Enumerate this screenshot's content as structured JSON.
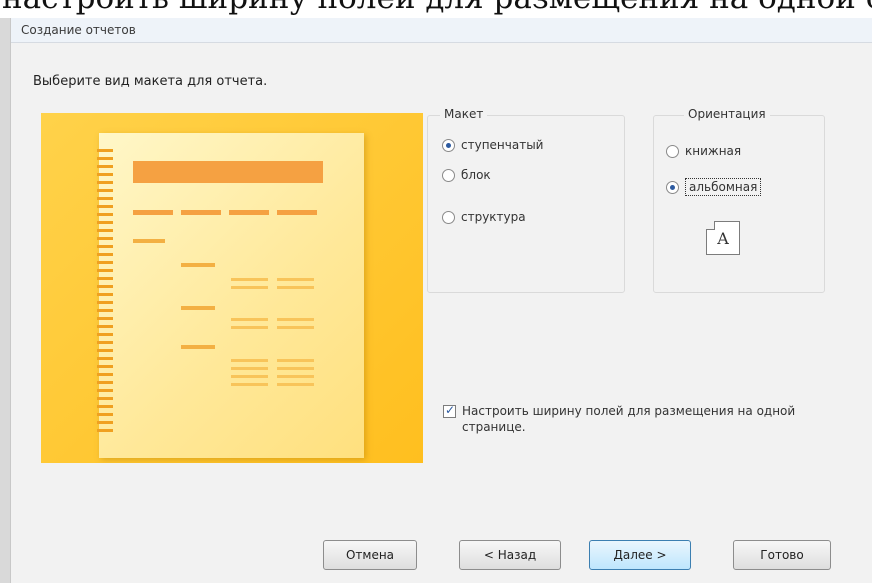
{
  "document_text": "настроить ширину полей для размещения на одной стр",
  "window": {
    "title": "Создание отчетов"
  },
  "prompt": "Выберите вид макета для отчета.",
  "layout_group": {
    "legend": "Макет",
    "options": [
      {
        "label": "ступенчатый",
        "selected": true
      },
      {
        "label": "блок",
        "selected": false
      },
      {
        "label": "структура",
        "selected": false
      }
    ]
  },
  "orientation_group": {
    "legend": "Ориентация",
    "options": [
      {
        "label": "книжная",
        "selected": false
      },
      {
        "label": "альбомная",
        "selected": true
      }
    ],
    "icon_letter": "A"
  },
  "fit_checkbox": {
    "checked": true,
    "label": "Настроить ширину полей для размещения на одной странице."
  },
  "buttons": {
    "cancel": "Отмена",
    "back": "< Назад",
    "next": "Далее >",
    "finish": "Готово"
  },
  "colors": {
    "preview_background": "#ffc52e",
    "accent": "#f5a142"
  },
  "icons": {
    "orientation_preview": "landscape-page-icon",
    "layout_preview": "report-layout-preview"
  }
}
